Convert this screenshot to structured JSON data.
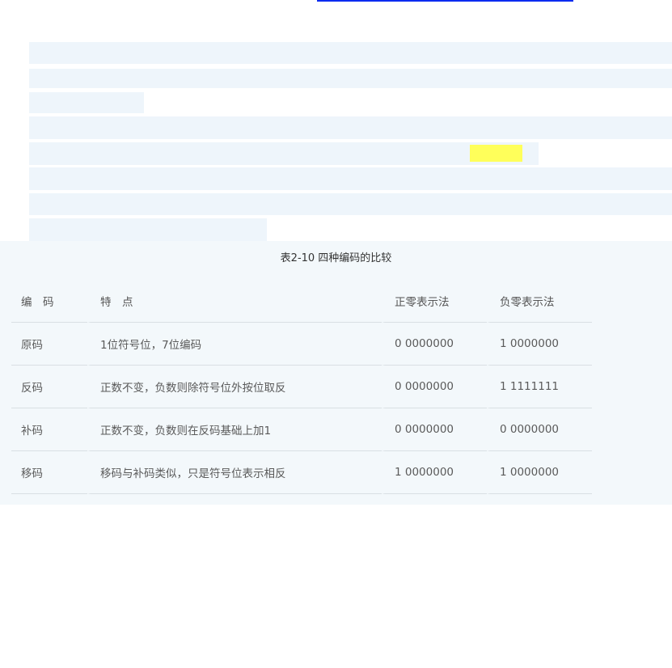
{
  "table": {
    "caption": "表2-10 四种编码的比较",
    "headers": [
      "编　码",
      "特　点",
      "正零表示法",
      "负零表示法"
    ],
    "rows": [
      [
        "原码",
        "1位符号位，7位编码",
        "0 0000000",
        "1 0000000"
      ],
      [
        "反码",
        "正数不变，负数则除符号位外按位取反",
        "0 0000000",
        "1 1111111"
      ],
      [
        "补码",
        "正数不变，负数则在反码基础上加1",
        "0 0000000",
        "0 0000000"
      ],
      [
        "移码",
        "移码与补码类似，只是符号位表示相反",
        "1 0000000",
        "1 0000000"
      ]
    ]
  },
  "colors": {
    "link_underline": "#0a2cf0",
    "redacted_bar": "#eef5fb",
    "highlight": "#ffff5a",
    "table_background": "#f3f8fb",
    "row_divider": "#d9dfe3"
  }
}
